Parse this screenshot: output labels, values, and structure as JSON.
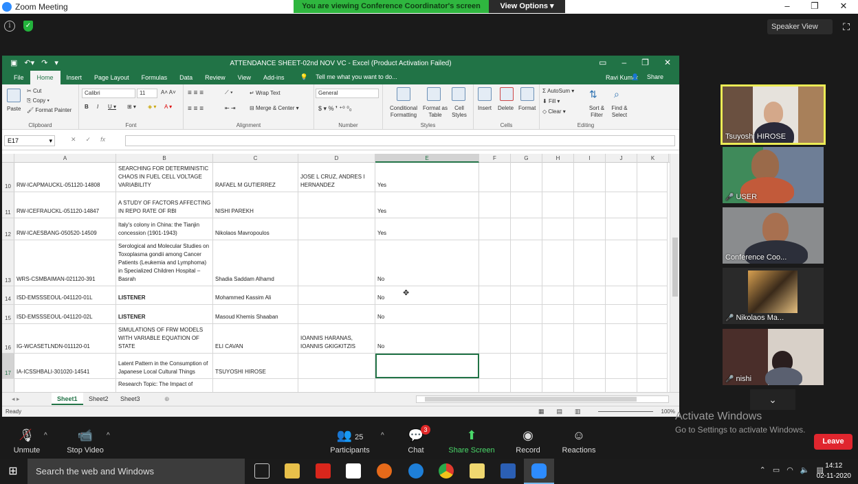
{
  "zoom": {
    "title": "Zoom Meeting",
    "viewing_banner": "You are viewing Conference Coordinator's screen",
    "view_options": "View Options",
    "speaker_view": "Speaker View"
  },
  "excel": {
    "title": "ATTENDANCE SHEET-02nd NOV VC - Excel (Product Activation Failed)",
    "menus": [
      "File",
      "Home",
      "Insert",
      "Page Layout",
      "Formulas",
      "Data",
      "Review",
      "View",
      "Add-ins"
    ],
    "tell_me": "Tell me what you want to do...",
    "user": "Ravi Kumar",
    "share": "Share",
    "ribbon": {
      "paste": "Paste",
      "cut": "Cut",
      "copy": "Copy",
      "format_painter": "Format Painter",
      "clipboard": "Clipboard",
      "font_name": "Calibri",
      "font_size": "11",
      "font": "Font",
      "wrap_text": "Wrap Text",
      "merge_center": "Merge & Center",
      "alignment": "Alignment",
      "number_format": "General",
      "number": "Number",
      "conditional_formatting": "Conditional Formatting",
      "format_as_table": "Format as Table",
      "cell_styles": "Cell Styles",
      "styles": "Styles",
      "insert": "Insert",
      "delete": "Delete",
      "format": "Format",
      "cells": "Cells",
      "autosum": "AutoSum",
      "fill": "Fill",
      "clear": "Clear",
      "sort_filter": "Sort & Filter",
      "find_select": "Find & Select",
      "editing": "Editing"
    },
    "name_box": "E17",
    "columns": [
      "A",
      "B",
      "C",
      "D",
      "E",
      "F",
      "G",
      "H",
      "I",
      "J",
      "K"
    ],
    "rows": [
      {
        "num": "10",
        "a": "RW-ICAPMAUCKL-051120-14808",
        "b": "SEARCHING FOR DETERMINISTIC CHAOS IN FUEL CELL VOLTAGE VARIABILITY",
        "c": "RAFAEL M GUTIERREZ",
        "d": "JOSE L CRUZ, ANDRES I HERNANDEZ",
        "e": "Yes"
      },
      {
        "num": "11",
        "a": "RW-ICEFRAUCKL-051120-14847",
        "b": "A STUDY OF FACTORS AFFECTING IN REPO RATE OF RBI",
        "c": "NISHI PAREKH",
        "d": "",
        "e": "Yes"
      },
      {
        "num": "12",
        "a": "RW-ICAESBANG-050520-14509",
        "b": "Italy's colony in China: the Tianjin concession (1901-1943)",
        "c": "Nikolaos Mavropoulos",
        "d": "",
        "e": "Yes"
      },
      {
        "num": "13",
        "a": "WRS-CSMBAIMAN-021120-391",
        "b": "Serological and Molecular Studies on Toxoplasma gondii among Cancer Patients (Leukemia and Lymphoma) in Specialized Children Hospital – Basrah",
        "c": "Shadia Saddam Alhamd",
        "d": "",
        "e": "No"
      },
      {
        "num": "14",
        "a": "ISD-EMSSSEOUL-041120-01L",
        "b": "LISTENER",
        "c": "Mohammed Kassim Ali",
        "d": "",
        "e": "No"
      },
      {
        "num": "15",
        "a": "ISD-EMSSSEOUL-041120-02L",
        "b": "LISTENER",
        "c": "Masoud Khemis Shaaban",
        "d": "",
        "e": "No"
      },
      {
        "num": "16",
        "a": "IG-WCASETLNDN-011120-01",
        "b": "SIMULATIONS OF FRW MODELS WITH VARIABLE EQUATION OF STATE",
        "c": "ELI CAVAN",
        "d": "IOANNIS HARANAS, IOANNIS GKIGKITZIS",
        "e": "No"
      },
      {
        "num": "17",
        "a": "IA-ICSSHBALI-301020-14541",
        "b": "Latent Pattern in the Consumption of Japanese Local Cultural Things",
        "c": "TSUYOSHI HIROSE",
        "d": "",
        "e": ""
      },
      {
        "num": "",
        "a": "",
        "b": "Research Topic: The Impact of",
        "c": "",
        "d": "",
        "e": ""
      }
    ],
    "sheets": [
      "Sheet1",
      "Sheet2",
      "Sheet3"
    ],
    "status": "Ready",
    "zoom_level": "100%"
  },
  "participants": [
    {
      "name": "Tsuyoshi HIROSE",
      "muted": false
    },
    {
      "name": "USER",
      "muted": true
    },
    {
      "name": "Conference Coo...",
      "muted": false
    },
    {
      "name": "Nikolaos Ma...",
      "muted": true
    },
    {
      "name": "nishi",
      "muted": true
    }
  ],
  "activate": {
    "line1": "Activate Windows",
    "line2": "Go to Settings to activate Windows."
  },
  "controls": {
    "unmute": "Unmute",
    "stop_video": "Stop Video",
    "participants": "Participants",
    "participants_count": "25",
    "chat": "Chat",
    "chat_badge": "3",
    "share_screen": "Share Screen",
    "record": "Record",
    "reactions": "Reactions",
    "leave": "Leave"
  },
  "taskbar": {
    "search": "Search the web and Windows",
    "time": "14:12",
    "date": "02-11-2020"
  }
}
